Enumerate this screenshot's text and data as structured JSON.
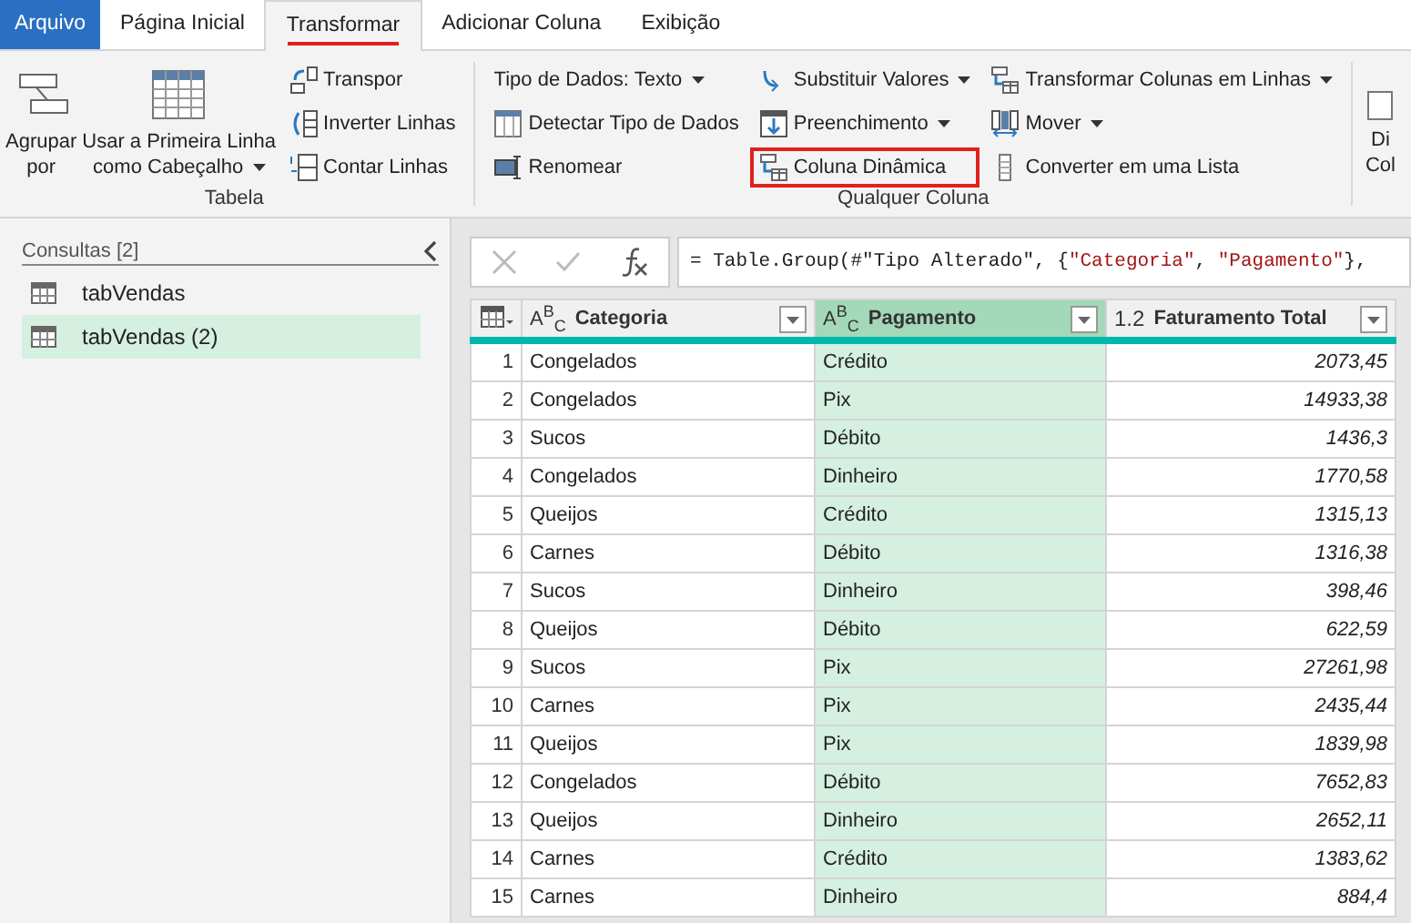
{
  "tabs": [
    {
      "label": "Arquivo",
      "kind": "file",
      "selected": false
    },
    {
      "label": "Página Inicial",
      "kind": "tab",
      "selected": false
    },
    {
      "label": "Transformar",
      "kind": "tab",
      "selected": true
    },
    {
      "label": "Adicionar Coluna",
      "kind": "tab",
      "selected": false
    },
    {
      "label": "Exibição",
      "kind": "tab",
      "selected": false
    }
  ],
  "ribbon": {
    "groups": [
      {
        "label": "Tabela",
        "large": [
          {
            "lines": [
              "Agrupar",
              "por"
            ],
            "dropdown": false
          },
          {
            "lines": [
              "Usar a Primeira Linha",
              "como Cabeçalho"
            ],
            "dropdown": true
          }
        ],
        "columns": [
          [
            {
              "label": "Transpor",
              "dropdown": false,
              "highlighted": false
            },
            {
              "label": "Inverter Linhas",
              "dropdown": false,
              "highlighted": false
            },
            {
              "label": "Contar Linhas",
              "dropdown": false,
              "highlighted": false
            }
          ]
        ]
      },
      {
        "label": "Qualquer Coluna",
        "columns": [
          [
            {
              "label": "Tipo de Dados: Texto",
              "dropdown": true,
              "highlighted": false
            },
            {
              "label": "Detectar Tipo de Dados",
              "dropdown": false,
              "highlighted": false
            },
            {
              "label": "Renomear",
              "dropdown": false,
              "highlighted": false
            }
          ],
          [
            {
              "label": "Substituir Valores",
              "dropdown": true,
              "highlighted": false
            },
            {
              "label": "Preenchimento",
              "dropdown": true,
              "highlighted": false
            },
            {
              "label": "Coluna Dinâmica",
              "dropdown": false,
              "highlighted": true
            }
          ],
          [
            {
              "label": "Transformar Colunas em Linhas",
              "dropdown": true,
              "highlighted": false
            },
            {
              "label": "Mover",
              "dropdown": true,
              "highlighted": false
            },
            {
              "label": "Converter em uma Lista",
              "dropdown": false,
              "highlighted": false
            }
          ]
        ]
      }
    ],
    "cut_button": {
      "lines": [
        "Di",
        "Col"
      ]
    }
  },
  "queries": {
    "title": "Consultas [2]",
    "items": [
      {
        "label": "tabVendas",
        "selected": false
      },
      {
        "label": "tabVendas (2)",
        "selected": true
      }
    ]
  },
  "formula": [
    {
      "kind": "plain",
      "text": "= Table.Group(#\"Tipo Alterado\", {"
    },
    {
      "kind": "string",
      "text": "\"Categoria\""
    },
    {
      "kind": "plain",
      "text": ", "
    },
    {
      "kind": "string",
      "text": "\"Pagamento\""
    },
    {
      "kind": "plain",
      "text": "},"
    }
  ],
  "table": {
    "columns": [
      {
        "name": "Categoria",
        "kind": "text",
        "type_icon": "A$^{B}$$_{C}$",
        "selected": false
      },
      {
        "name": "Pagamento",
        "kind": "text",
        "type_icon": "A$^{B}$$_{C}$",
        "selected": true
      },
      {
        "name": "Faturamento Total",
        "kind": "number",
        "type_icon": "1.2",
        "selected": false
      }
    ],
    "rows": [
      {
        "number": "1",
        "cells": [
          "Congelados",
          "Crédito",
          "2073,45"
        ]
      },
      {
        "number": "2",
        "cells": [
          "Congelados",
          "Pix",
          "14933,38"
        ]
      },
      {
        "number": "3",
        "cells": [
          "Sucos",
          "Débito",
          "1436,3"
        ]
      },
      {
        "number": "4",
        "cells": [
          "Congelados",
          "Dinheiro",
          "1770,58"
        ]
      },
      {
        "number": "5",
        "cells": [
          "Queijos",
          "Crédito",
          "1315,13"
        ]
      },
      {
        "number": "6",
        "cells": [
          "Carnes",
          "Débito",
          "1316,38"
        ]
      },
      {
        "number": "7",
        "cells": [
          "Sucos",
          "Dinheiro",
          "398,46"
        ]
      },
      {
        "number": "8",
        "cells": [
          "Queijos",
          "Débito",
          "622,59"
        ]
      },
      {
        "number": "9",
        "cells": [
          "Sucos",
          "Pix",
          "27261,98"
        ]
      },
      {
        "number": "10",
        "cells": [
          "Carnes",
          "Pix",
          "2435,44"
        ]
      },
      {
        "number": "11",
        "cells": [
          "Queijos",
          "Pix",
          "1839,98"
        ]
      },
      {
        "number": "12",
        "cells": [
          "Congelados",
          "Débito",
          "7652,83"
        ]
      },
      {
        "number": "13",
        "cells": [
          "Queijos",
          "Dinheiro",
          "2652,11"
        ]
      },
      {
        "number": "14",
        "cells": [
          "Carnes",
          "Crédito",
          "1383,62"
        ]
      },
      {
        "number": "15",
        "cells": [
          "Carnes",
          "Dinheiro",
          "884,4"
        ]
      }
    ]
  }
}
